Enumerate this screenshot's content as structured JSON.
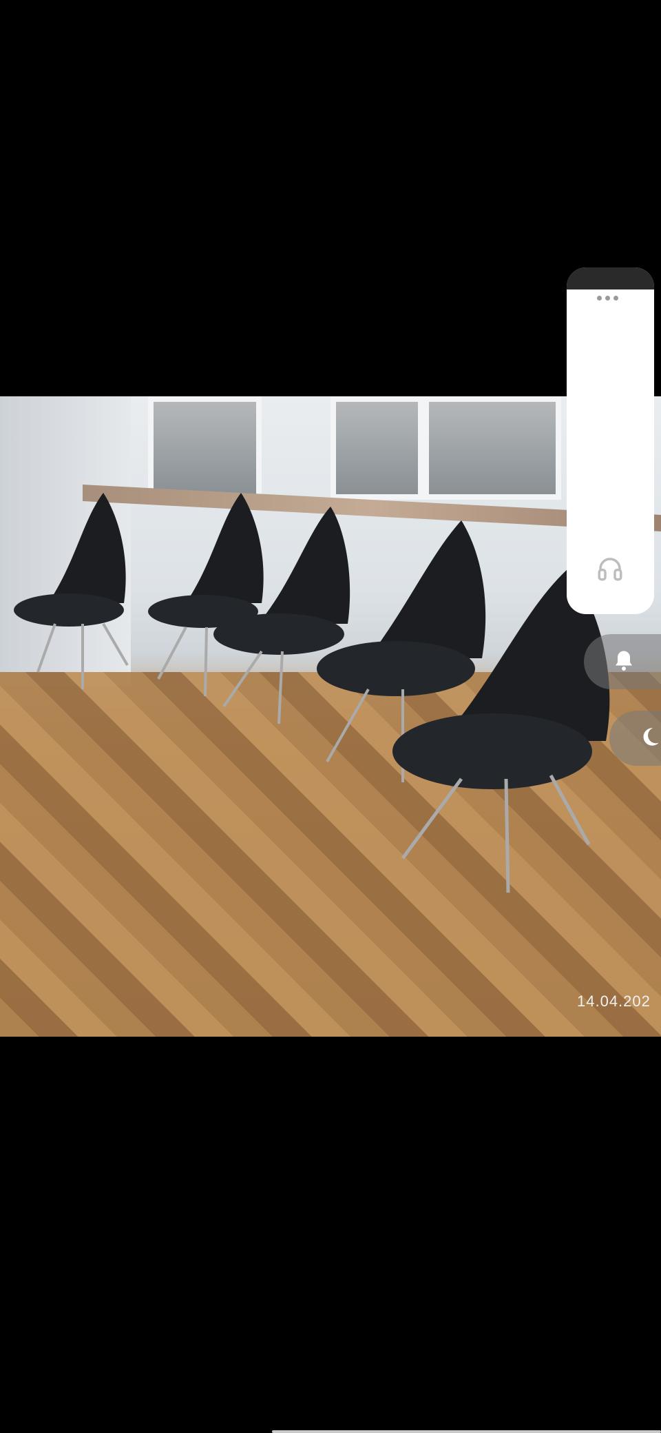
{
  "photo": {
    "description_icon": "photo-content",
    "date_stamp": "14.04.202"
  },
  "floating_panel": {
    "handle_icon": "more-dots-icon",
    "audio_icon": "headphones-icon"
  },
  "side_buttons": {
    "notification_icon": "bell-icon",
    "dark_mode_icon": "moon-icon"
  },
  "colors": {
    "background": "#000000",
    "panel": "#ffffff",
    "side_button": "#787878"
  }
}
